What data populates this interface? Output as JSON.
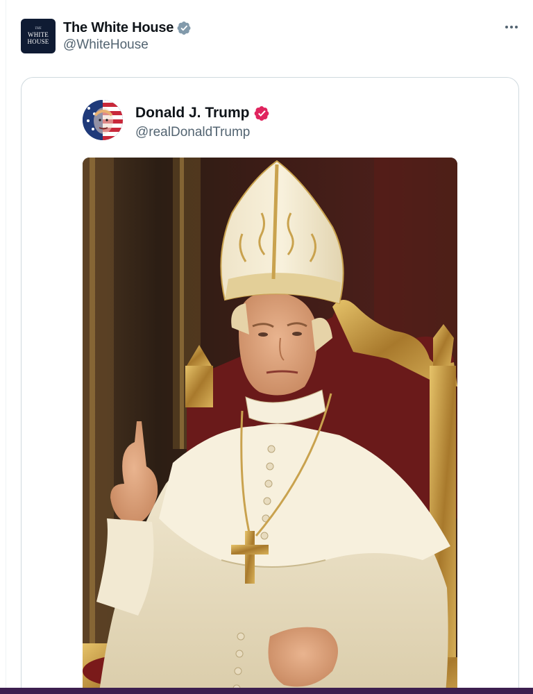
{
  "post": {
    "author": {
      "name": "The White House",
      "handle": "@WhiteHouse",
      "verified": true,
      "avatar_text": [
        "THE",
        "WHITE",
        "HOUSE"
      ],
      "avatar_bg": "#0f1b33"
    },
    "more_icon": "more-horizontal-icon"
  },
  "quoted_post": {
    "author": {
      "name": "Donald J. Trump",
      "handle": "@realDonaldTrump",
      "verified": true,
      "badge_color": "#e0245e"
    },
    "image": {
      "icon": "photo-illustration"
    }
  },
  "colors": {
    "text_primary": "#0f1419",
    "text_secondary": "#536471",
    "verified_gray": "#829aab",
    "verified_pink": "#e0245e",
    "card_border": "#cfd9de"
  }
}
